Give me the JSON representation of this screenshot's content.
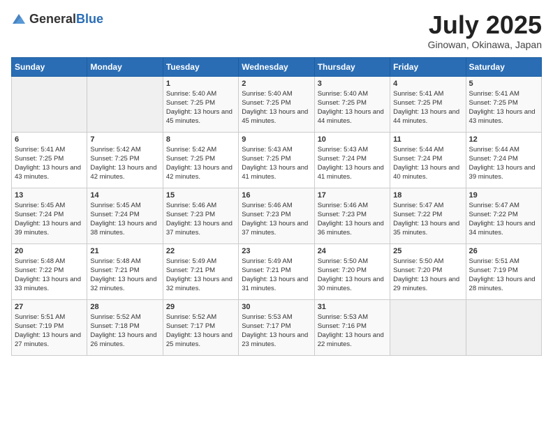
{
  "logo": {
    "general": "General",
    "blue": "Blue"
  },
  "title": {
    "month": "July 2025",
    "location": "Ginowan, Okinawa, Japan"
  },
  "weekdays": [
    "Sunday",
    "Monday",
    "Tuesday",
    "Wednesday",
    "Thursday",
    "Friday",
    "Saturday"
  ],
  "weeks": [
    [
      {
        "day": "",
        "info": ""
      },
      {
        "day": "",
        "info": ""
      },
      {
        "day": "1",
        "info": "Sunrise: 5:40 AM\nSunset: 7:25 PM\nDaylight: 13 hours and 45 minutes."
      },
      {
        "day": "2",
        "info": "Sunrise: 5:40 AM\nSunset: 7:25 PM\nDaylight: 13 hours and 45 minutes."
      },
      {
        "day": "3",
        "info": "Sunrise: 5:40 AM\nSunset: 7:25 PM\nDaylight: 13 hours and 44 minutes."
      },
      {
        "day": "4",
        "info": "Sunrise: 5:41 AM\nSunset: 7:25 PM\nDaylight: 13 hours and 44 minutes."
      },
      {
        "day": "5",
        "info": "Sunrise: 5:41 AM\nSunset: 7:25 PM\nDaylight: 13 hours and 43 minutes."
      }
    ],
    [
      {
        "day": "6",
        "info": "Sunrise: 5:41 AM\nSunset: 7:25 PM\nDaylight: 13 hours and 43 minutes."
      },
      {
        "day": "7",
        "info": "Sunrise: 5:42 AM\nSunset: 7:25 PM\nDaylight: 13 hours and 42 minutes."
      },
      {
        "day": "8",
        "info": "Sunrise: 5:42 AM\nSunset: 7:25 PM\nDaylight: 13 hours and 42 minutes."
      },
      {
        "day": "9",
        "info": "Sunrise: 5:43 AM\nSunset: 7:25 PM\nDaylight: 13 hours and 41 minutes."
      },
      {
        "day": "10",
        "info": "Sunrise: 5:43 AM\nSunset: 7:24 PM\nDaylight: 13 hours and 41 minutes."
      },
      {
        "day": "11",
        "info": "Sunrise: 5:44 AM\nSunset: 7:24 PM\nDaylight: 13 hours and 40 minutes."
      },
      {
        "day": "12",
        "info": "Sunrise: 5:44 AM\nSunset: 7:24 PM\nDaylight: 13 hours and 39 minutes."
      }
    ],
    [
      {
        "day": "13",
        "info": "Sunrise: 5:45 AM\nSunset: 7:24 PM\nDaylight: 13 hours and 39 minutes."
      },
      {
        "day": "14",
        "info": "Sunrise: 5:45 AM\nSunset: 7:24 PM\nDaylight: 13 hours and 38 minutes."
      },
      {
        "day": "15",
        "info": "Sunrise: 5:46 AM\nSunset: 7:23 PM\nDaylight: 13 hours and 37 minutes."
      },
      {
        "day": "16",
        "info": "Sunrise: 5:46 AM\nSunset: 7:23 PM\nDaylight: 13 hours and 37 minutes."
      },
      {
        "day": "17",
        "info": "Sunrise: 5:46 AM\nSunset: 7:23 PM\nDaylight: 13 hours and 36 minutes."
      },
      {
        "day": "18",
        "info": "Sunrise: 5:47 AM\nSunset: 7:22 PM\nDaylight: 13 hours and 35 minutes."
      },
      {
        "day": "19",
        "info": "Sunrise: 5:47 AM\nSunset: 7:22 PM\nDaylight: 13 hours and 34 minutes."
      }
    ],
    [
      {
        "day": "20",
        "info": "Sunrise: 5:48 AM\nSunset: 7:22 PM\nDaylight: 13 hours and 33 minutes."
      },
      {
        "day": "21",
        "info": "Sunrise: 5:48 AM\nSunset: 7:21 PM\nDaylight: 13 hours and 32 minutes."
      },
      {
        "day": "22",
        "info": "Sunrise: 5:49 AM\nSunset: 7:21 PM\nDaylight: 13 hours and 32 minutes."
      },
      {
        "day": "23",
        "info": "Sunrise: 5:49 AM\nSunset: 7:21 PM\nDaylight: 13 hours and 31 minutes."
      },
      {
        "day": "24",
        "info": "Sunrise: 5:50 AM\nSunset: 7:20 PM\nDaylight: 13 hours and 30 minutes."
      },
      {
        "day": "25",
        "info": "Sunrise: 5:50 AM\nSunset: 7:20 PM\nDaylight: 13 hours and 29 minutes."
      },
      {
        "day": "26",
        "info": "Sunrise: 5:51 AM\nSunset: 7:19 PM\nDaylight: 13 hours and 28 minutes."
      }
    ],
    [
      {
        "day": "27",
        "info": "Sunrise: 5:51 AM\nSunset: 7:19 PM\nDaylight: 13 hours and 27 minutes."
      },
      {
        "day": "28",
        "info": "Sunrise: 5:52 AM\nSunset: 7:18 PM\nDaylight: 13 hours and 26 minutes."
      },
      {
        "day": "29",
        "info": "Sunrise: 5:52 AM\nSunset: 7:17 PM\nDaylight: 13 hours and 25 minutes."
      },
      {
        "day": "30",
        "info": "Sunrise: 5:53 AM\nSunset: 7:17 PM\nDaylight: 13 hours and 23 minutes."
      },
      {
        "day": "31",
        "info": "Sunrise: 5:53 AM\nSunset: 7:16 PM\nDaylight: 13 hours and 22 minutes."
      },
      {
        "day": "",
        "info": ""
      },
      {
        "day": "",
        "info": ""
      }
    ]
  ]
}
